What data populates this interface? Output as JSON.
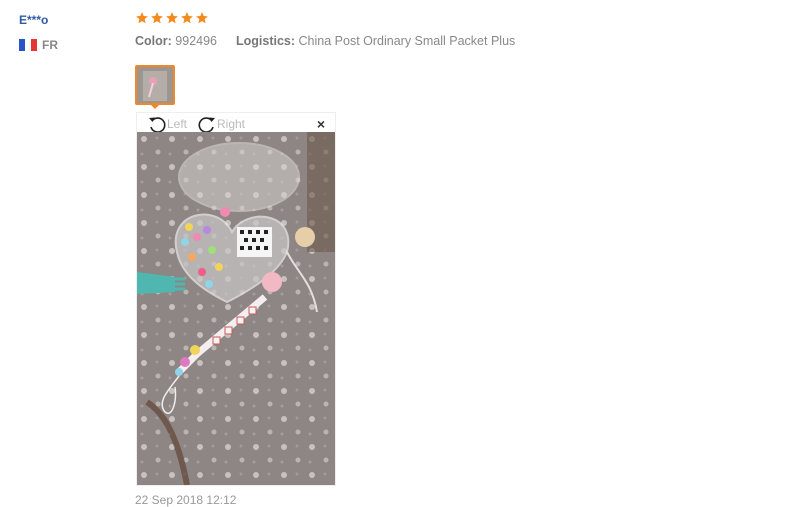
{
  "review": {
    "user_name": "E***o",
    "country_code": "FR",
    "flag_colors": [
      "#2855c9",
      "#ffffff",
      "#e53535"
    ],
    "rating": 5,
    "star_color": "#f28a1c",
    "color_label": "Color:",
    "color_value": "992496",
    "logistics_label": "Logistics:",
    "logistics_value": "China Post Ordinary Small Packet Plus",
    "date": "22 Sep 2018 12:12"
  },
  "viewer": {
    "rotate_left_label": "Left",
    "rotate_right_label": "Right",
    "close_label": "×",
    "close_icon": "close-icon"
  }
}
